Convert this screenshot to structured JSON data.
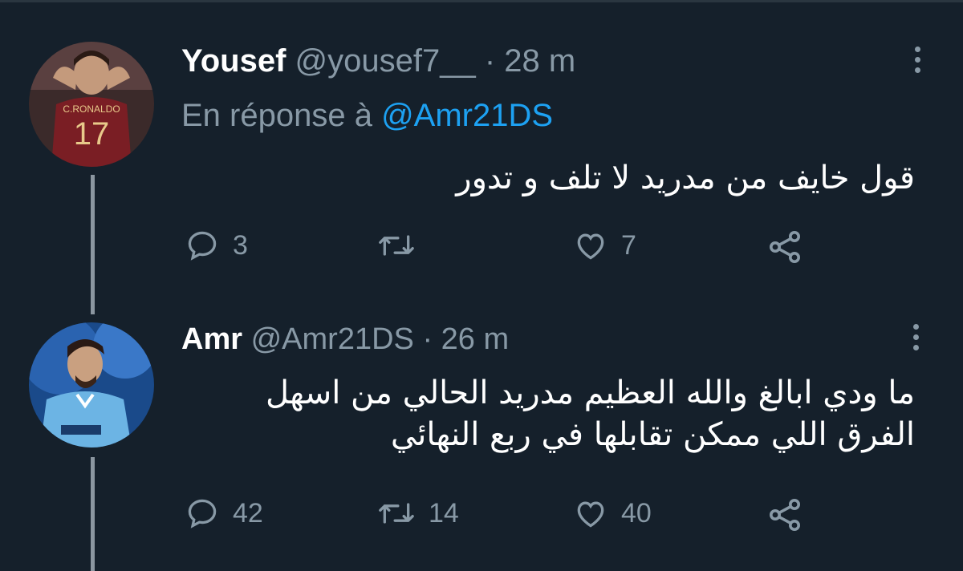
{
  "tweets": [
    {
      "name": "Yousef",
      "handle": "@yousef7__",
      "sep": "·",
      "time": "28 m",
      "reply_prefix": "En réponse à",
      "reply_mention": "@Amr21DS",
      "body_lines": [
        "قول خايف من مدريد لا تلف و تدور"
      ],
      "replies": "3",
      "retweets": "",
      "likes": "7",
      "avatar_jersey_name": "C.RONALDO",
      "avatar_jersey_number": "17"
    },
    {
      "name": "Amr",
      "handle": "@Amr21DS",
      "sep": "·",
      "time": "26 m",
      "body_lines": [
        "ما ودي ابالغ والله العظيم مدريد الحالي من اسهل",
        "الفرق اللي ممكن تقابلها في ربع النهائي"
      ],
      "replies": "42",
      "retweets": "14",
      "likes": "40"
    }
  ],
  "colors": {
    "background": "#15202b",
    "secondary_text": "#8899a6",
    "mention": "#1da1f2",
    "thread_line": "#8b96a0"
  },
  "icons": [
    "reply-icon",
    "retweet-icon",
    "like-icon",
    "share-icon",
    "more-options-icon"
  ]
}
